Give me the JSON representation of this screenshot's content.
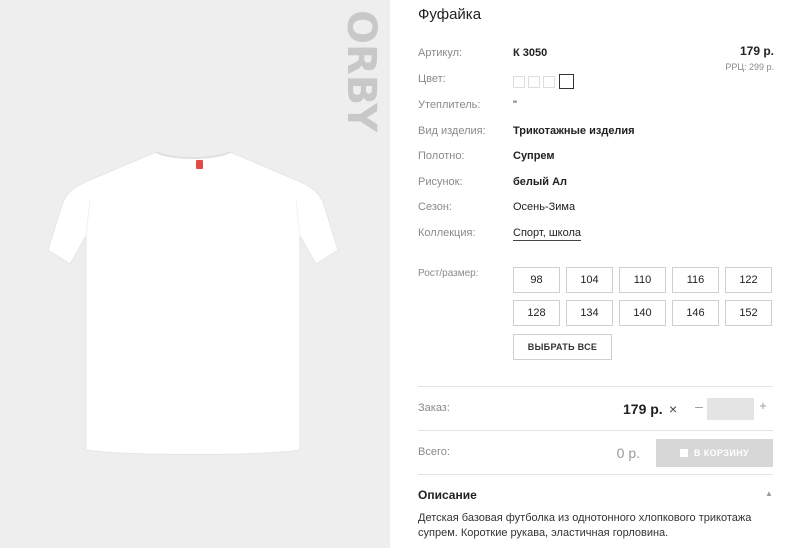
{
  "product": {
    "title": "Фуфайка",
    "price": "179 р.",
    "rrp": "РРЦ: 299 р."
  },
  "brand": {
    "logo_text": "ORBY"
  },
  "specs": [
    {
      "label": "Артикул:",
      "value": "К 3050",
      "bold": true
    },
    {
      "label": "Цвет:",
      "value": ""
    },
    {
      "label": "Утеплитель:",
      "value": "\""
    },
    {
      "label": "Вид изделия:",
      "value": "Трикотажные изделия",
      "bold": true
    },
    {
      "label": "Полотно:",
      "value": "Супрем",
      "bold": true
    },
    {
      "label": "Рисунок:",
      "value": "белый Ал",
      "bold": true
    },
    {
      "label": "Сезон:",
      "value": "Осень-Зима"
    },
    {
      "label": "Коллекция:",
      "value": "Спорт, школа",
      "link": true
    }
  ],
  "colors": {
    "swatch_count": 4,
    "selected_index": 3
  },
  "sizes": {
    "label": "Рост/размер:",
    "options": [
      "98",
      "104",
      "110",
      "116",
      "122",
      "128",
      "134",
      "140",
      "146",
      "152"
    ],
    "select_all_label": "ВЫБРАТЬ ВСЕ"
  },
  "order": {
    "label": "Заказ:",
    "price": "179 р.",
    "times": "×",
    "minus": "–",
    "plus": "+",
    "quantity": ""
  },
  "total": {
    "label": "Всего:",
    "value": "0 р.",
    "cart_label": "В КОРЗИНУ"
  },
  "description": {
    "title": "Описание",
    "text": "Детская базовая футболка из однотонного хлопкового трикотажа супрем. Короткие рукава, эластичная горловина."
  }
}
